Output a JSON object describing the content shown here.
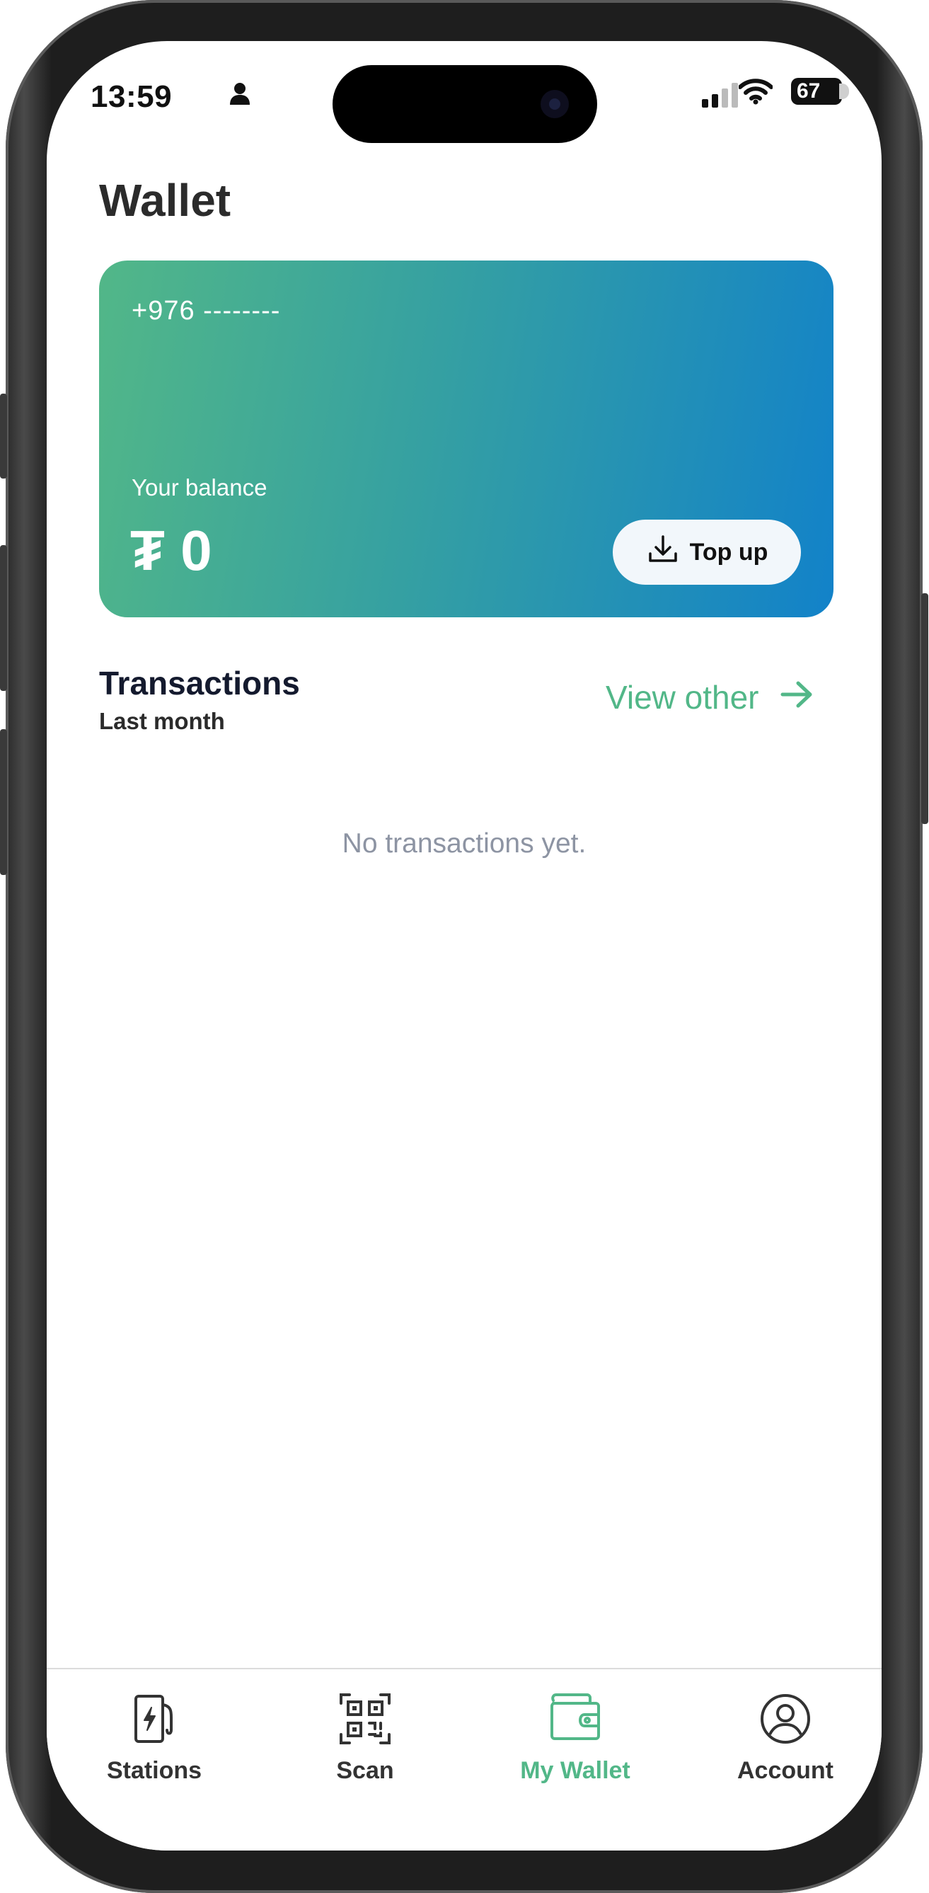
{
  "status_bar": {
    "time": "13:59",
    "battery": "67"
  },
  "page": {
    "title": "Wallet"
  },
  "wallet_card": {
    "phone": "+976 --------",
    "balance_label": "Your balance",
    "balance_value": "₮ 0",
    "topup_label": "Top up",
    "gradient_start": "#52b788",
    "gradient_end": "#1282c9"
  },
  "transactions": {
    "title": "Transactions",
    "period": "Last month",
    "view_other_label": "View other",
    "empty_message": "No transactions yet."
  },
  "tab_bar": {
    "items": [
      {
        "label": "Stations",
        "icon": "charging-station-icon",
        "active": false
      },
      {
        "label": "Scan",
        "icon": "qr-code-icon",
        "active": false
      },
      {
        "label": "My Wallet",
        "icon": "wallet-icon",
        "active": true
      },
      {
        "label": "Account",
        "icon": "account-icon",
        "active": false
      }
    ],
    "active_color": "#52b788"
  }
}
